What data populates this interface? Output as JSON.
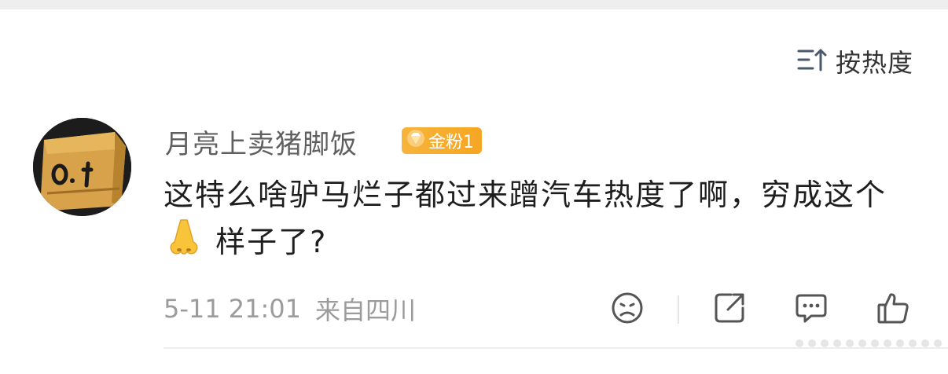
{
  "sort": {
    "label": "按热度",
    "icon": "sort-lines-up-icon"
  },
  "comment": {
    "username": "月亮上卖猪脚饭",
    "badge": {
      "label": "金粉1",
      "icon": "gem-icon",
      "color": "#F5A623"
    },
    "text_part1": "这特么啥驴马烂子都过来蹭汽车热度了啊，穷成这个",
    "text_part2": "样子了?",
    "inline_emoji": "nose-emoji",
    "meta": {
      "time": "5-11 21:01",
      "location": "来自四川"
    },
    "actions": [
      "sad-face-icon",
      "share-icon",
      "comment-icon",
      "like-icon"
    ]
  }
}
